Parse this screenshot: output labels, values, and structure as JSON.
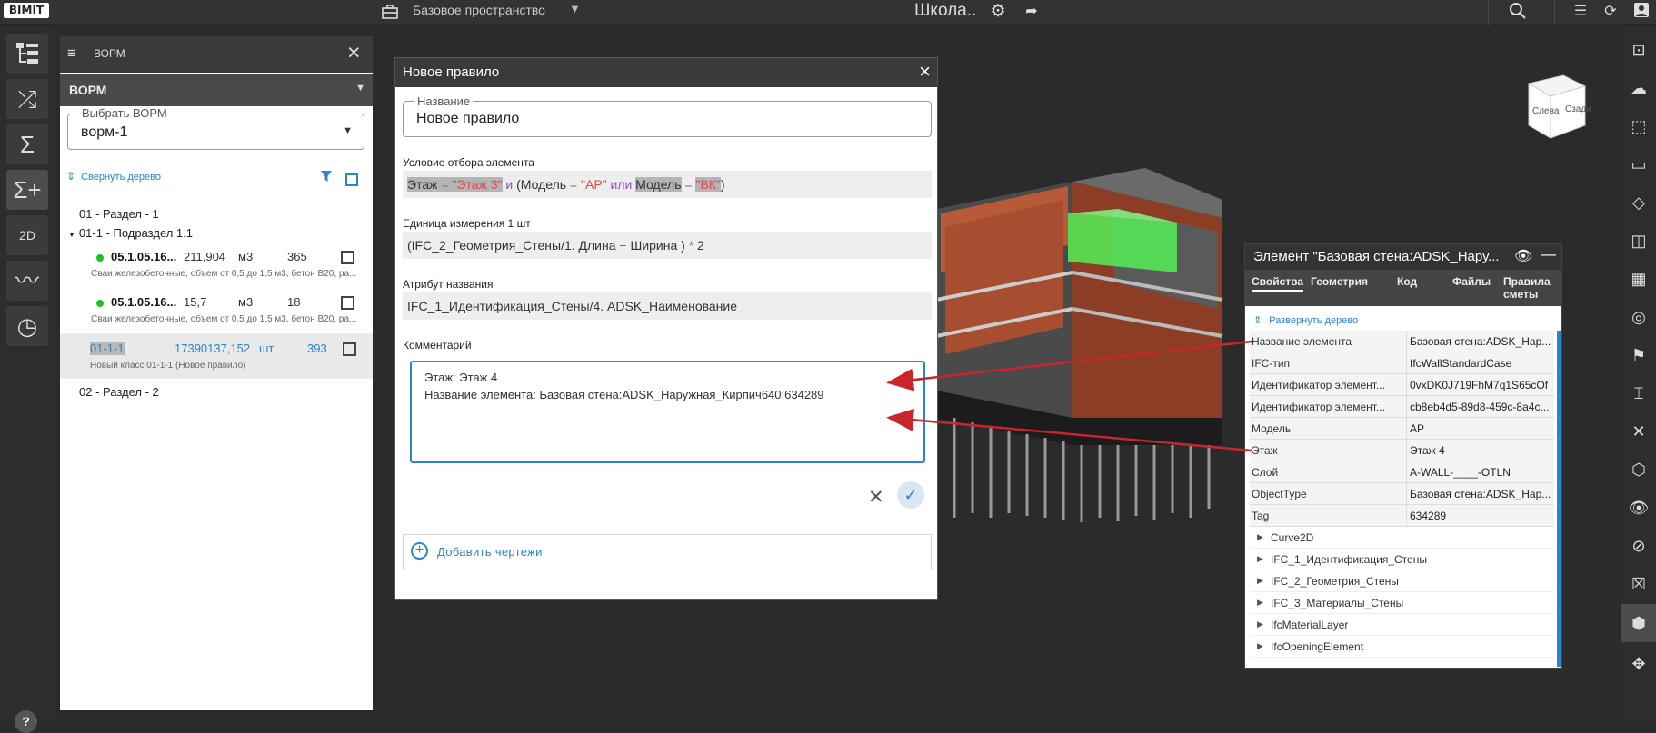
{
  "app": {
    "logo": "BIMIT",
    "workspace": "Базовое пространство",
    "project_title": "Школа.."
  },
  "vorm_panel": {
    "title": "ВОРМ",
    "dropdown": "ВОРМ",
    "select_label": "Выбрать ВОРМ",
    "select_value": "ворм-1",
    "collapse_tree": "Свернуть дерево",
    "tree": {
      "section1": "01 - Раздел - 1",
      "subsection": "01-1 - Подраздел 1.1",
      "items": [
        {
          "code": "05.1.05.16...",
          "qty": "211,904",
          "unit": "м3",
          "count": "365",
          "desc": "Сваи железобетонные, объем от 0,5 до 1,5 м3, бетон B20, ра..."
        },
        {
          "code": "05.1.05.16...",
          "qty": "15,7",
          "unit": "м3",
          "count": "18",
          "desc": "Сваи железобетонные, объем от 0,5 до 1,5 м3, бетон B20, ра..."
        },
        {
          "code": "01-1-1",
          "qty": "17390137,152",
          "unit": "шт",
          "count": "393",
          "desc": "Новый класс 01-1-1 (Новое правило)"
        }
      ],
      "section2": "02 - Раздел - 2"
    }
  },
  "dialog": {
    "title": "Новое правило",
    "name_label": "Название",
    "name_value": "Новое правило",
    "condition_label": "Условие отбора элемента",
    "condition": {
      "p1": "Этаж",
      "p2": " = ",
      "p3": "\"Этаж 3\"",
      "p4": " и ",
      "p5": "(Модель",
      "p6": " = ",
      "p7": "\"АР\"",
      "p8": " или ",
      "p9": "Модель",
      "p10": " = ",
      "p11": "\"ВК\"",
      "p12": ")"
    },
    "unit_label": "Единица измерения 1 шт",
    "unit": {
      "p1": "(IFC_2_Геометрия_Стены/1. Длина",
      "p2": " + ",
      "p3": "Ширина )",
      "p4": " * ",
      "p5": "2"
    },
    "name_attr_label": "Атрибут названия",
    "name_attr": "IFC_1_Идентификация_Стены/4. ADSK_Наименование",
    "comment_label": "Комментарий",
    "comment_line1": "Этаж: Этаж 4",
    "comment_line2": "Название элемента: Базовая стена:ADSK_Наружная_Кирпич640:634289",
    "add_drawings": "Добавить чертежи",
    "colors": {
      "accent": "#2a86c9",
      "red": "#e0484f",
      "purple": "#9b4ac7"
    }
  },
  "properties": {
    "title": "Элемент \"Базовая стена:ADSK_Нару...",
    "tabs": [
      "Свойства",
      "Геометрия",
      "Код",
      "Файлы",
      "Правила сметы"
    ],
    "expand_tree": "Развернуть дерево",
    "rows": [
      {
        "key": "Название элемента",
        "value": "Базовая стена:ADSK_Нар..."
      },
      {
        "key": "IFC-тип",
        "value": "IfcWallStandardCase"
      },
      {
        "key": "Идентификатор элемент...",
        "value": "0vxDK0J719FhM7q1S65cOf"
      },
      {
        "key": "Идентификатор элемент...",
        "value": "cb8eb4d5-89d8-459c-8a4c..."
      },
      {
        "key": "Модель",
        "value": "АР"
      },
      {
        "key": "Этаж",
        "value": "Этаж 4"
      },
      {
        "key": "Слой",
        "value": "A-WALL-____-OTLN"
      },
      {
        "key": "ObjectType",
        "value": "Базовая стена:ADSK_Нар..."
      },
      {
        "key": "Tag",
        "value": "634289"
      }
    ],
    "groups": [
      "Curve2D",
      "IFC_1_Идентификация_Стены",
      "IFC_2_Геометрия_Стены",
      "IFC_3_Материалы_Стены",
      "IfcMaterialLayer",
      "IfcOpeningElement"
    ]
  },
  "view_cube": {
    "left": "Слева",
    "back": "Сзади"
  }
}
